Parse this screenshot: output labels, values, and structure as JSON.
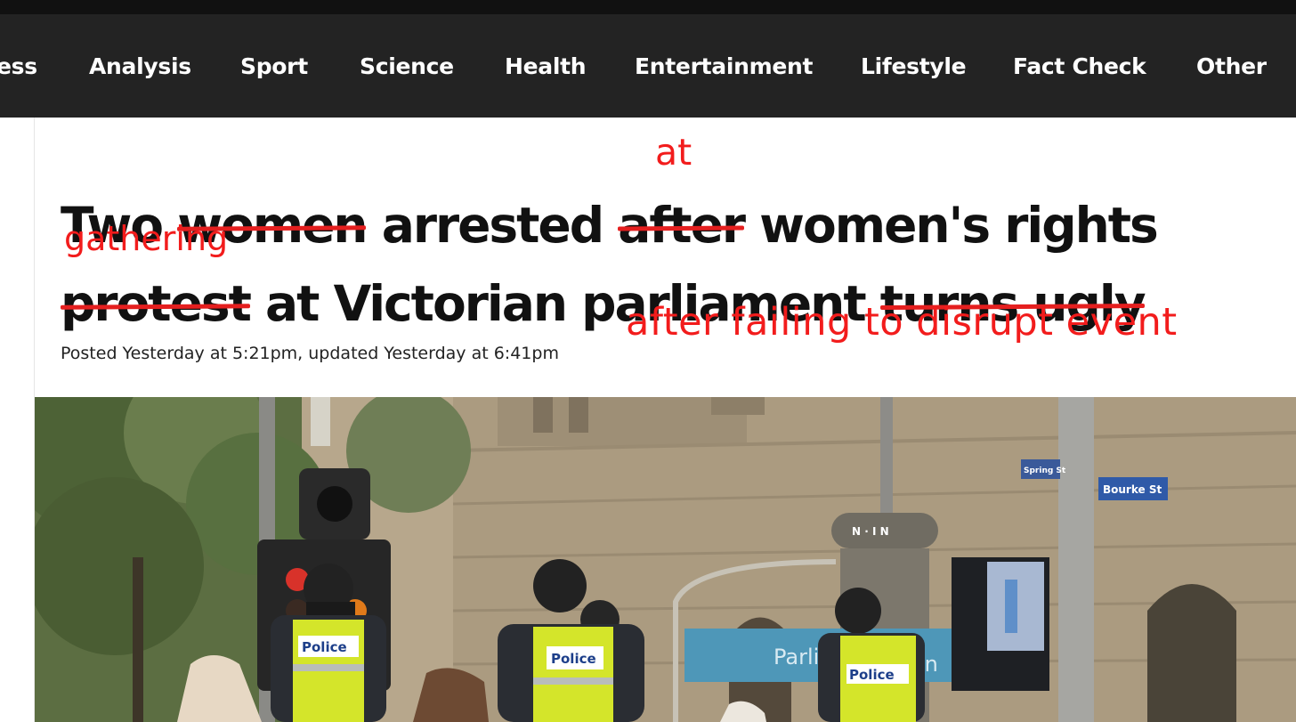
{
  "nav": {
    "items": [
      "ess",
      "Analysis",
      "Sport",
      "Science",
      "Health",
      "Entertainment",
      "Lifestyle",
      "Fact Check",
      "Other"
    ]
  },
  "article": {
    "headline": {
      "line1": [
        "Two ",
        "women",
        " arrested ",
        "after",
        " women's rights"
      ],
      "line2": [
        "protest",
        " at Victorian parliament ",
        "turns ugly"
      ]
    },
    "meta": "Posted Yesterday at 5:21pm, updated Yesterday at 6:41pm"
  },
  "annotations": {
    "insert_at": "at",
    "insert_gathering": "gathering",
    "insert_after": "after failing to disrupt event",
    "color": "#f21c1c"
  },
  "photo": {
    "police_label": "Police",
    "street_sign_1": "Spring St",
    "street_sign_2": "Bourke St",
    "station_sign": "Parliament Station",
    "station_sign_left": "Parliar",
    "station_sign_right": "on",
    "ring_text": "N · I N"
  },
  "colors": {
    "nav_bg": "#232323",
    "top_bar": "#111111",
    "headline": "#111111",
    "strike": "#e51f1f"
  }
}
